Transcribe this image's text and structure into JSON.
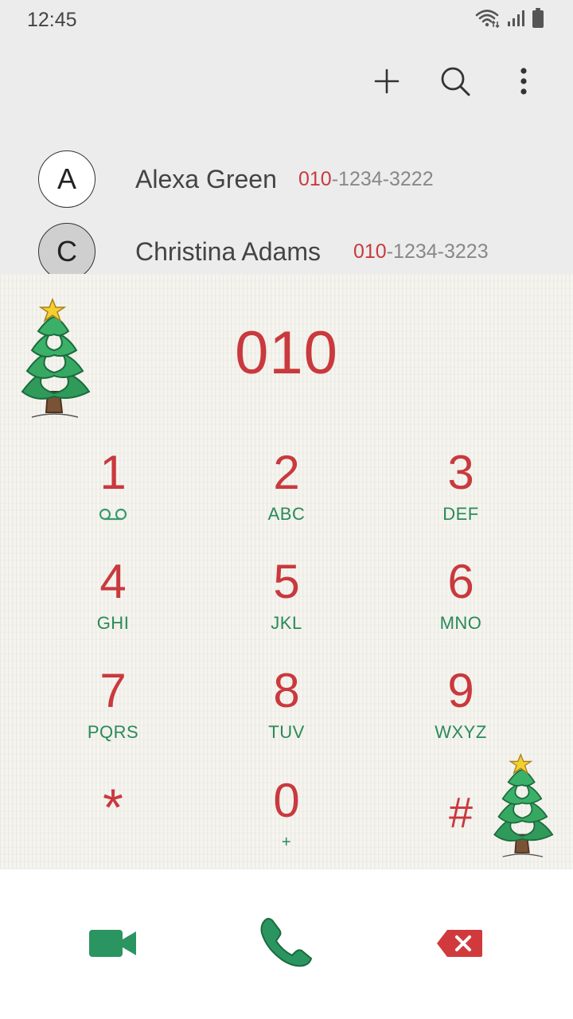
{
  "status_bar": {
    "time": "12:45",
    "icons": [
      "wifi-icon",
      "signal-icon",
      "battery-icon"
    ]
  },
  "action_bar": {
    "icons": [
      "add-icon",
      "search-icon",
      "more-options-icon"
    ]
  },
  "suggestions": [
    {
      "initial": "A",
      "name": "Alexa Green",
      "number_match": "010",
      "number_rest": "-1234-3222"
    },
    {
      "initial": "C",
      "name": "Christina Adams",
      "number_match": "010",
      "number_rest": "-1234-3223"
    }
  ],
  "dialer": {
    "input": "010",
    "keys": [
      {
        "digit": "1",
        "letters": "",
        "sub_icon": "voicemail-icon"
      },
      {
        "digit": "2",
        "letters": "ABC"
      },
      {
        "digit": "3",
        "letters": "DEF"
      },
      {
        "digit": "4",
        "letters": "GHI"
      },
      {
        "digit": "5",
        "letters": "JKL"
      },
      {
        "digit": "6",
        "letters": "MNO"
      },
      {
        "digit": "7",
        "letters": "PQRS"
      },
      {
        "digit": "8",
        "letters": "TUV"
      },
      {
        "digit": "9",
        "letters": "WXYZ"
      },
      {
        "digit": "*",
        "letters": ""
      },
      {
        "digit": "0",
        "letters": "+"
      },
      {
        "digit": "#",
        "letters": ""
      }
    ]
  },
  "bottom_bar": {
    "icons": [
      "video-call-icon",
      "phone-call-icon",
      "backspace-icon"
    ]
  },
  "colors": {
    "accent_red": "#c9393d",
    "accent_green": "#2a8a57",
    "header_bg": "#ececec",
    "pad_bg": "#f5f4ef"
  }
}
